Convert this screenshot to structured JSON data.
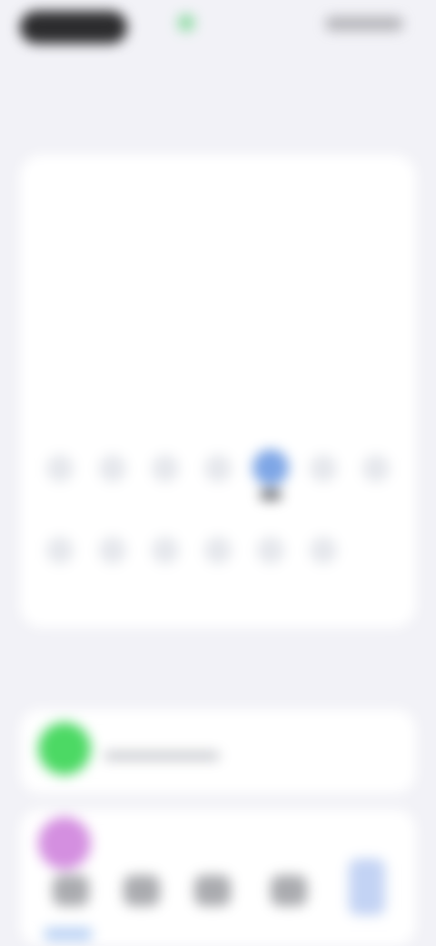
{
  "status_bar": {
    "app_name": ""
  },
  "header": {
    "title": "",
    "action_label": ""
  },
  "calendar": {
    "section_label": "",
    "section_link": "",
    "weekdays": [
      "",
      "",
      "",
      "",
      "",
      "",
      ""
    ],
    "today_index": 25,
    "cells": [
      {
        "day": ""
      },
      {
        "day": ""
      },
      {
        "day": ""
      },
      {
        "day": ""
      },
      {
        "day": ""
      },
      {
        "day": ""
      },
      {
        "day": ""
      },
      {
        "day": ""
      },
      {
        "day": ""
      },
      {
        "day": ""
      },
      {
        "day": ""
      },
      {
        "day": ""
      },
      {
        "day": ""
      },
      {
        "day": ""
      },
      {
        "day": ""
      },
      {
        "day": ""
      },
      {
        "day": ""
      },
      {
        "day": ""
      },
      {
        "day": ""
      },
      {
        "day": ""
      },
      {
        "day": ""
      },
      {
        "day": ""
      },
      {
        "day": ""
      },
      {
        "day": ""
      },
      {
        "day": ""
      },
      {
        "day": ""
      },
      {
        "day": ""
      },
      {
        "day": ""
      },
      {
        "day": ""
      },
      {
        "day": ""
      },
      {
        "day": ""
      },
      {
        "day": ""
      },
      {
        "day": ""
      },
      {
        "day": ""
      },
      {
        "day": ""
      }
    ],
    "filled_cells": [
      21,
      22,
      23,
      24,
      25,
      26,
      27,
      28,
      29,
      30,
      31,
      32,
      33
    ]
  },
  "activity": {
    "header": "",
    "link": "",
    "items": [
      {
        "title": "",
        "value": "",
        "icon": "activity-ring-icon",
        "icon_color": "#4cd964"
      },
      {
        "title": "",
        "value": "",
        "icon": "mindfulness-icon",
        "icon_color": "#c56ad6"
      }
    ]
  },
  "tabbar": {
    "tabs": [
      {
        "icon": "home-icon"
      },
      {
        "icon": "calendar-icon"
      },
      {
        "icon": "stats-icon"
      },
      {
        "icon": "profile-icon"
      },
      {
        "icon": "settings-icon"
      }
    ],
    "active_index": 4
  }
}
